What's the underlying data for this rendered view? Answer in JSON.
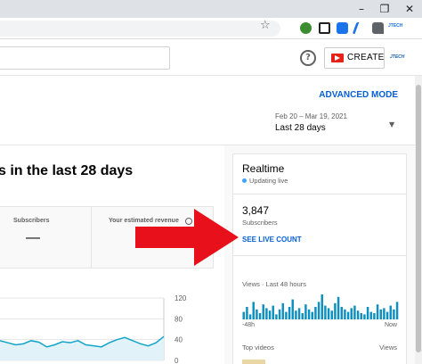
{
  "browser": {
    "window_controls": [
      "–",
      "❐",
      "✕"
    ],
    "extensions": [
      "shield-icon",
      "cast-icon",
      "p-extension-icon",
      "pen-icon",
      "puzzle-icon",
      "brand-extension-icon"
    ]
  },
  "header": {
    "create_label": "CREATE"
  },
  "analytics": {
    "advanced_mode": "ADVANCED MODE",
    "date_range": "Feb 20 – Mar 19, 2021",
    "date_preset": "Last 28 days",
    "heading": "s in the last 28 days",
    "metrics": [
      {
        "title": "Subscribers",
        "value": "—"
      },
      {
        "title": "Your estimated revenue",
        "value": ""
      }
    ],
    "chart_yticks": [
      "120",
      "80",
      "40",
      "0"
    ]
  },
  "realtime": {
    "title": "Realtime",
    "status": "Updating live",
    "subscriber_count": "3,847",
    "subscribers_label": "Subscribers",
    "live_count_link": "SEE LIVE COUNT",
    "views_label": "Views · Last 48 hours",
    "axis_left": "-48h",
    "axis_right": "Now",
    "top_videos_label": "Top videos",
    "views_col_label": "Views"
  },
  "colors": {
    "accent": "#065fd4",
    "chart_line": "#12a4c9",
    "bar": "#0f8fbf",
    "arrow": "#e8101a"
  },
  "chart_data": {
    "type": "line",
    "ylim": [
      0,
      120
    ],
    "yticks": [
      0,
      40,
      80,
      120
    ],
    "values": [
      38,
      34,
      30,
      32,
      38,
      35,
      26,
      30,
      36,
      34,
      38,
      30,
      28,
      26,
      34,
      40,
      44,
      38,
      32,
      28,
      34,
      46
    ]
  },
  "realtime_bars": [
    6,
    10,
    4,
    14,
    8,
    5,
    12,
    9,
    7,
    11,
    4,
    8,
    13,
    6,
    10,
    16,
    7,
    9,
    5,
    12,
    8,
    6,
    10,
    14,
    20,
    11,
    9,
    7,
    13,
    18,
    10,
    8,
    6,
    9,
    11,
    7,
    5,
    4,
    10,
    6,
    5,
    12,
    8,
    9,
    6,
    11,
    8,
    14
  ]
}
